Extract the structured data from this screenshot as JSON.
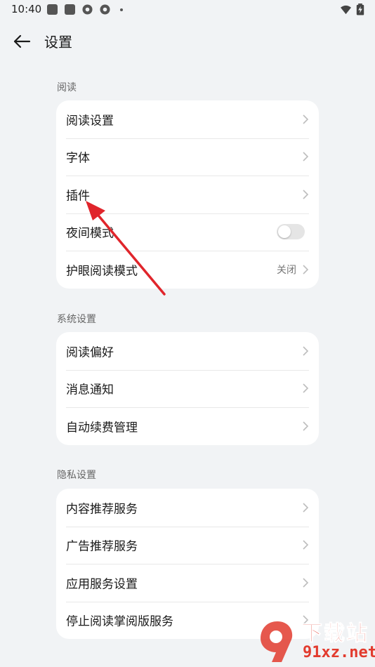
{
  "status_bar": {
    "time": "10:40"
  },
  "header": {
    "title": "设置"
  },
  "sections": [
    {
      "label": "阅读",
      "items": [
        {
          "label": "阅读设置"
        },
        {
          "label": "字体"
        },
        {
          "label": "插件"
        },
        {
          "label": "夜间模式",
          "toggle": false
        },
        {
          "label": "护眼阅读模式",
          "value": "关闭"
        }
      ]
    },
    {
      "label": "系统设置",
      "items": [
        {
          "label": "阅读偏好"
        },
        {
          "label": "消息通知"
        },
        {
          "label": "自动续费管理"
        }
      ]
    },
    {
      "label": "隐私设置",
      "items": [
        {
          "label": "内容推荐服务"
        },
        {
          "label": "广告推荐服务"
        },
        {
          "label": "应用服务设置"
        },
        {
          "label": "停止阅读掌阅版服务"
        }
      ]
    }
  ],
  "watermark": {
    "top": "下载站",
    "bottom": "91xz.net"
  },
  "colors": {
    "background": "#f1f3f5",
    "card": "#ffffff",
    "annotation_arrow": "#e0252b",
    "watermark": "#e23b2e"
  }
}
